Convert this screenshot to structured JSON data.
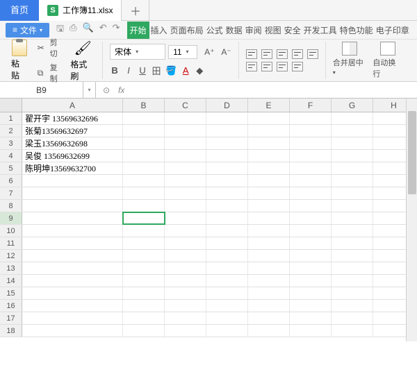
{
  "tabs": {
    "home": "首页",
    "workbook": "工作簿11.xlsx",
    "badge": "S"
  },
  "menu": {
    "file": "文件",
    "tabs": [
      "开始",
      "插入",
      "页面布局",
      "公式",
      "数据",
      "审阅",
      "视图",
      "安全",
      "开发工具",
      "特色功能",
      "电子印章"
    ]
  },
  "ribbon": {
    "paste": "粘贴",
    "cut": "剪切",
    "copy": "复制",
    "brush": "格式刷",
    "fontName": "宋体",
    "fontSize": "11",
    "merge": "合并居中",
    "wrap": "自动换行"
  },
  "namebox": "B9",
  "fx": "fx",
  "columns": [
    "A",
    "B",
    "C",
    "D",
    "E",
    "F",
    "G",
    "H"
  ],
  "rows": {
    "1": {
      "A": "翟开宇 13569632696"
    },
    "2": {
      "A": "张菊13569632697"
    },
    "3": {
      "A": "梁玉13569632698"
    },
    "4": {
      "A": "吴俊 13569632699"
    },
    "5": {
      "A": "陈明坤13569632700"
    }
  },
  "selectedCell": "B9",
  "visibleRows": 18
}
